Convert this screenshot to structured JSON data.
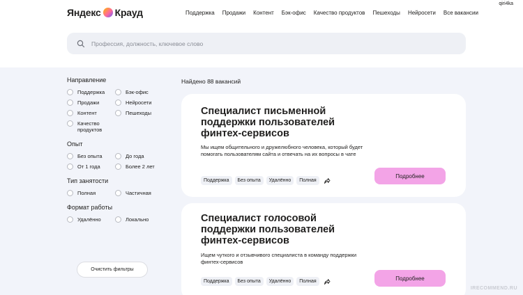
{
  "header": {
    "logo_text_1": "Яндекс",
    "logo_text_2": "Крауд",
    "user": "qiri4ka",
    "nav": [
      "Поддержка",
      "Продажи",
      "Контент",
      "Бэк-офис",
      "Качество продуктов",
      "Пешеходы",
      "Нейросети",
      "Все вакансии"
    ]
  },
  "search": {
    "placeholder": "Профессия, должность, ключевое слово"
  },
  "filters": {
    "direction": {
      "title": "Направление",
      "options": [
        "Поддержка",
        "Бэк-офис",
        "Продажи",
        "Нейросети",
        "Контент",
        "Пешеходы",
        "Качество продуктов"
      ]
    },
    "experience": {
      "title": "Опыт",
      "options": [
        "Без опыта",
        "До года",
        "От 1 года",
        "Более 2 лет"
      ]
    },
    "employment": {
      "title": "Тип занятости",
      "options": [
        "Полная",
        "Частичная"
      ]
    },
    "work_format": {
      "title": "Формат работы",
      "options": [
        "Удалённо",
        "Локально"
      ]
    },
    "clear_label": "Очистить фильтры"
  },
  "results": {
    "found_text": "Найдено 88 вакансий",
    "vacancies": [
      {
        "title": "Специалист письменной поддержки пользователей финтех-сервисов",
        "description": "Мы ищем общительного и дружелюбного человека, который будет помогать пользователям сайта и отвечать на их вопросы в чате",
        "tags": [
          "Поддержка",
          "Без опыта",
          "Удалённо",
          "Полная"
        ],
        "button": "Подробнее"
      },
      {
        "title": "Специалист голосовой поддержки пользователей финтех-сервисов",
        "description": "Ищем чуткого и отзывчивого специалиста в команду поддержки финтех-сервисов",
        "tags": [
          "Поддержка",
          "Без опыта",
          "Удалённо",
          "Полная"
        ],
        "button": "Подробнее"
      }
    ]
  },
  "watermark": "IRECOMMEND.RU",
  "colors": {
    "accent_button": "#f3a4e7",
    "page_bg": "#f2f4fa"
  }
}
